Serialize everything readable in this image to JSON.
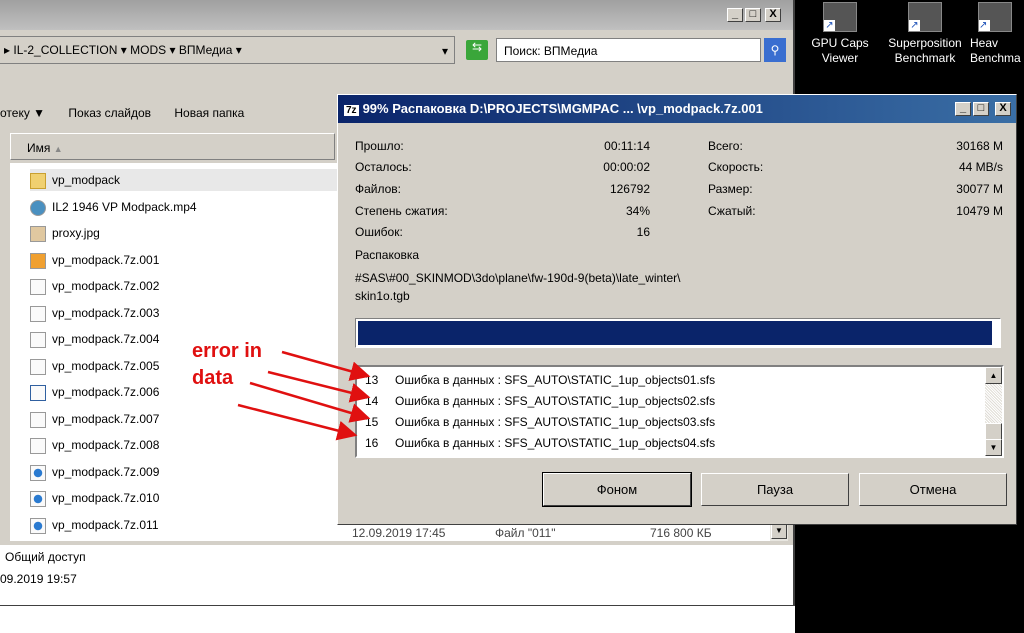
{
  "explorer": {
    "breadcrumb": [
      "IL-2_COLLECTION",
      "MODS",
      "ВПМедиа"
    ],
    "search_placeholder": "Поиск: ВПМедиа",
    "toolbar": {
      "library": "отеку ▼",
      "slideshow": "Показ слайдов",
      "new_folder": "Новая папка"
    },
    "column_name": "Имя",
    "files": [
      "vp_modpack",
      "IL2 1946  VP Modpack.mp4",
      "proxy.jpg",
      "vp_modpack.7z.001",
      "vp_modpack.7z.002",
      "vp_modpack.7z.003",
      "vp_modpack.7z.004",
      "vp_modpack.7z.005",
      "vp_modpack.7z.006",
      "vp_modpack.7z.007",
      "vp_modpack.7z.008",
      "vp_modpack.7z.009",
      "vp_modpack.7z.010",
      "vp_modpack.7z.011"
    ],
    "last_row": {
      "date": "12.09.2019 17:45",
      "type": "Файл \"011\"",
      "size": "716 800 КБ"
    },
    "details": {
      "sharing": "Общий доступ",
      "date": "09.2019 19:57"
    }
  },
  "desktop": {
    "icons": [
      "GPU Caps Viewer",
      "Superposition Benchmark",
      "Heav Benchma"
    ]
  },
  "dialog": {
    "title": "99% Распаковка D:\\PROJECTS\\MGMPAC ... \\vp_modpack.7z.001",
    "progress_percent": 99,
    "left_stats": [
      {
        "label": "Прошло:",
        "value": "00:11:14"
      },
      {
        "label": "Осталось:",
        "value": "00:00:02"
      },
      {
        "label": "Файлов:",
        "value": "126792"
      },
      {
        "label": "Степень сжатия:",
        "value": "34%"
      },
      {
        "label": "Ошибок:",
        "value": "16"
      }
    ],
    "right_stats": [
      {
        "label": "Всего:",
        "value": "30168 M"
      },
      {
        "label": "Скорость:",
        "value": "44 MB/s"
      },
      {
        "label": "Размер:",
        "value": "30077 M"
      },
      {
        "label": "Сжатый:",
        "value": "10479 M"
      }
    ],
    "operation": "Распаковка",
    "path_line1": "#SAS\\#00_SKINMOD\\3do\\plane\\fw-190d-9(beta)\\late_winter\\",
    "path_line2": "skin1o.tgb",
    "log": [
      {
        "n": "13",
        "msg": "Ошибка в данных : SFS_AUTO\\STATIC_1up_objects01.sfs"
      },
      {
        "n": "14",
        "msg": "Ошибка в данных : SFS_AUTO\\STATIC_1up_objects02.sfs"
      },
      {
        "n": "15",
        "msg": "Ошибка в данных : SFS_AUTO\\STATIC_1up_objects03.sfs"
      },
      {
        "n": "16",
        "msg": "Ошибка в данных : SFS_AUTO\\STATIC_1up_objects04.sfs"
      }
    ],
    "buttons": {
      "background": "Фоном",
      "pause": "Пауза",
      "cancel": "Отмена"
    }
  },
  "annotation": {
    "line1": "error in",
    "line2": "data",
    "color": "#e01010"
  }
}
